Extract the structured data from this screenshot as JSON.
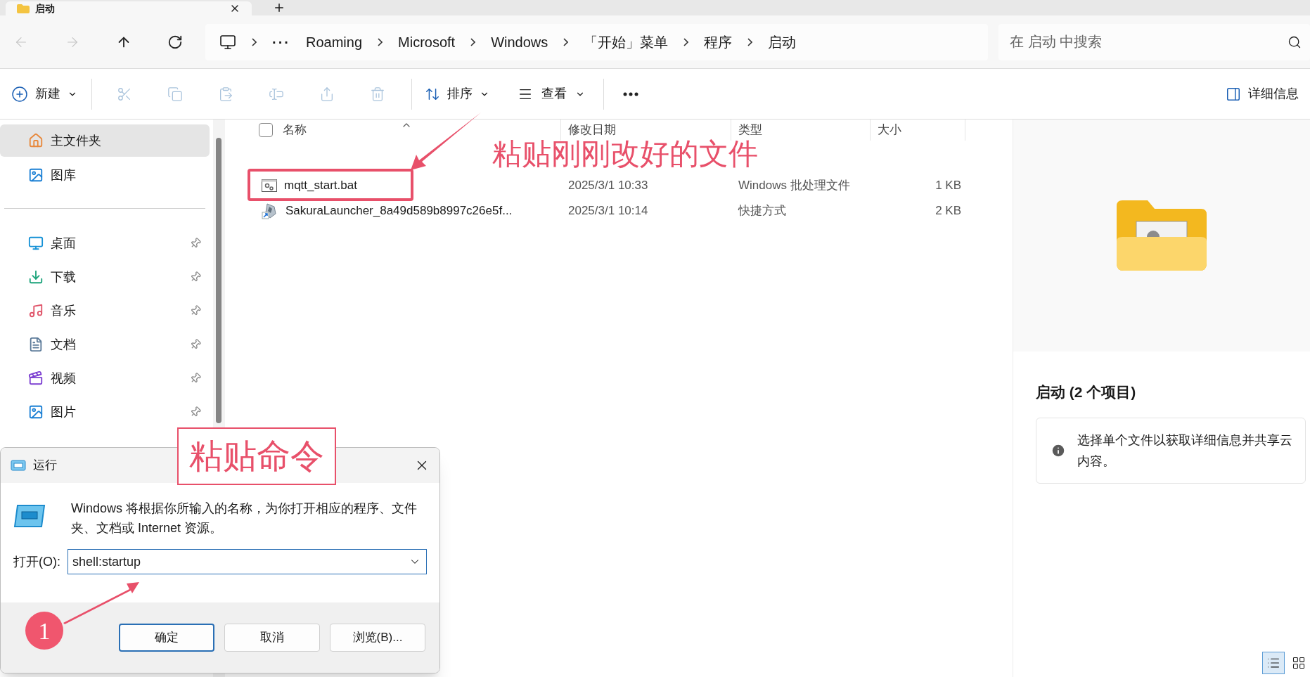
{
  "tab": {
    "title": "启动"
  },
  "nav": [
    {
      "kind": "back",
      "disabled": true
    },
    {
      "kind": "forward",
      "disabled": true
    },
    {
      "kind": "up",
      "disabled": false
    },
    {
      "kind": "refresh",
      "disabled": false
    }
  ],
  "address": {
    "overflow": "···",
    "crumbs": [
      "Roaming",
      "Microsoft",
      "Windows",
      "「开始」菜单",
      "程序",
      "启动"
    ]
  },
  "search": {
    "placeholder": "在 启动 中搜索"
  },
  "toolbar": {
    "new": {
      "label": "新建"
    },
    "actions": [
      {
        "kind": "cut",
        "disabled": true
      },
      {
        "kind": "copy",
        "disabled": true
      },
      {
        "kind": "paste",
        "disabled": true
      },
      {
        "kind": "rename",
        "disabled": true
      },
      {
        "kind": "share",
        "disabled": true
      },
      {
        "kind": "delete",
        "disabled": true
      }
    ],
    "sort": {
      "label": "排序"
    },
    "view": {
      "label": "查看"
    },
    "details": {
      "label": "详细信息"
    }
  },
  "sidebar": {
    "top": [
      {
        "kind": "home",
        "label": "主文件夹",
        "selected": true,
        "pinned": false
      },
      {
        "kind": "gallery",
        "label": "图库",
        "selected": false,
        "pinned": false
      }
    ],
    "quick": [
      {
        "kind": "desktop",
        "label": "桌面",
        "selected": false,
        "pinned": true
      },
      {
        "kind": "downloads",
        "label": "下载",
        "selected": false,
        "pinned": true
      },
      {
        "kind": "music",
        "label": "音乐",
        "selected": false,
        "pinned": true
      },
      {
        "kind": "documents",
        "label": "文档",
        "selected": false,
        "pinned": true
      },
      {
        "kind": "videos",
        "label": "视频",
        "selected": false,
        "pinned": true
      },
      {
        "kind": "pictures",
        "label": "图片",
        "selected": false,
        "pinned": true
      }
    ]
  },
  "table": {
    "select_all": {
      "checked": false
    },
    "columns": [
      "名称",
      "修改日期",
      "类型",
      "大小"
    ],
    "rows": [
      {
        "kind": "batch",
        "name": "mqtt_start.bat",
        "date": "2025/3/1 10:33",
        "type": "Windows 批处理文件",
        "size": "1 KB"
      },
      {
        "kind": "shortcut",
        "name": "SakuraLauncher_8a49d589b8997c26e5f...",
        "date": "2025/3/1 10:14",
        "type": "快捷方式",
        "size": "2 KB"
      }
    ]
  },
  "details_pane": {
    "title": "启动 (2 个项目)",
    "info": "选择单个文件以获取详细信息并共享云内容。"
  },
  "view_toggle": [
    {
      "kind": "details",
      "selected": true
    },
    {
      "kind": "tiles",
      "selected": false
    }
  ],
  "run_dialog": {
    "title": "运行",
    "description": "Windows 将根据你所输入的名称，为你打开相应的程序、文件夹、文档或 Internet 资源。",
    "open_label": "打开(O):",
    "value": "shell:startup",
    "buttons": [
      {
        "label": "确定",
        "default": true
      },
      {
        "label": "取消",
        "default": false
      },
      {
        "label": "浏览(B)...",
        "default": false
      }
    ]
  },
  "annotations": {
    "file_note": "粘贴刚刚改好的文件",
    "command_note": "粘贴命令",
    "step_badge": "1"
  }
}
